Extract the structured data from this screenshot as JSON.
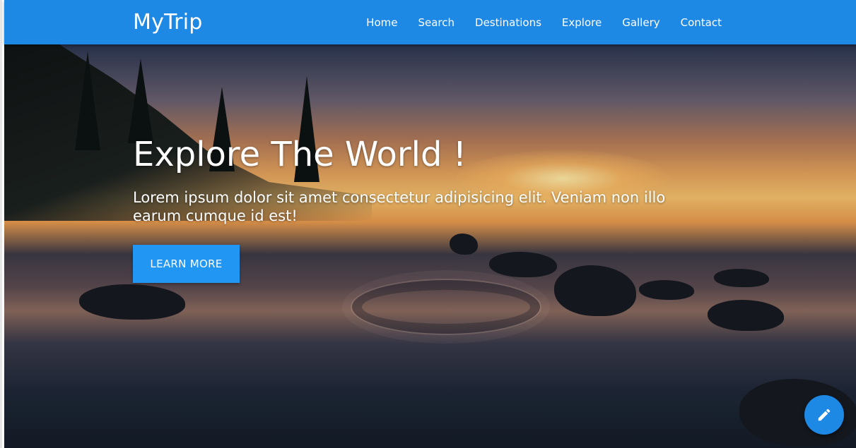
{
  "brand": "MyTrip",
  "nav": {
    "items": [
      "Home",
      "Search",
      "Destinations",
      "Explore",
      "Gallery",
      "Contact"
    ]
  },
  "hero": {
    "headline": "Explore The World !",
    "lead": "Lorem ipsum dolor sit amet consectetur adipisicing elit. Veniam non illo earum cumque id est!",
    "button_label": "LEARN MORE"
  },
  "fab": {
    "icon": "pencil-icon"
  },
  "colors": {
    "primary": "#1e88e5",
    "button": "#2196f3"
  }
}
